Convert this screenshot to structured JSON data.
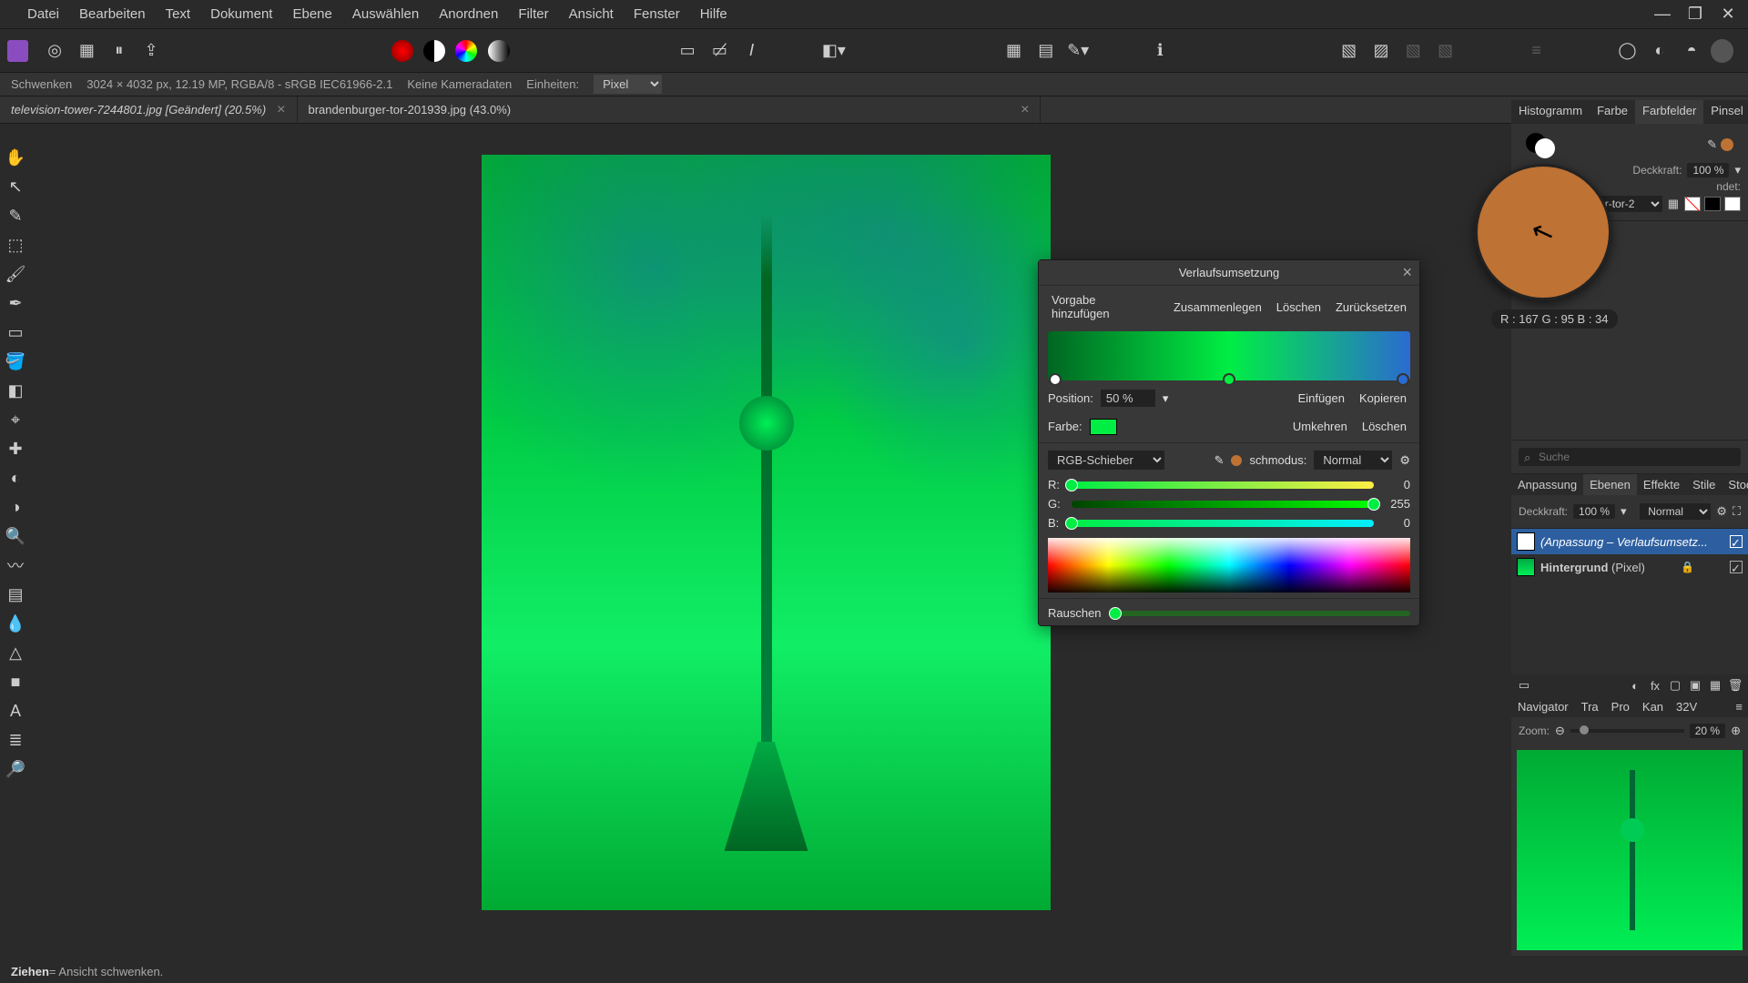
{
  "window": {
    "minimize": "—",
    "maximize": "❐",
    "close": "✕"
  },
  "menu": [
    "Datei",
    "Bearbeiten",
    "Text",
    "Dokument",
    "Ebene",
    "Auswählen",
    "Anordnen",
    "Filter",
    "Ansicht",
    "Fenster",
    "Hilfe"
  ],
  "info": {
    "tool": "Schwenken",
    "dims": "3024 × 4032 px, 12.19 MP, RGBA/8 - sRGB IEC61966-2.1",
    "camera": "Keine Kameradaten",
    "units_label": "Einheiten:",
    "units_value": "Pixel"
  },
  "tabs": [
    {
      "label": "television-tower-7244801.jpg [Geändert] (20.5%)"
    },
    {
      "label": "brandenburger-tor-201939.jpg (43.0%)"
    }
  ],
  "dialog": {
    "title": "Verlaufsumsetzung",
    "add_preset": "Vorgabe hinzufügen",
    "merge": "Zusammenlegen",
    "delete": "Löschen",
    "reset": "Zurücksetzen",
    "position_label": "Position:",
    "position_value": "50 %",
    "color_label": "Farbe:",
    "insert": "Einfügen",
    "copy": "Kopieren",
    "invert": "Umkehren",
    "delete2": "Löschen",
    "slider_mode": "RGB-Schieber",
    "blend_label": "schmodus:",
    "blend_value": "Normal",
    "r_label": "R:",
    "g_label": "G:",
    "b_label": "B:",
    "r_value": "0",
    "g_value": "255",
    "b_value": "0",
    "noise_label": "Rauschen"
  },
  "magnifier": {
    "readout": "R : 167 G : 95 B : 34"
  },
  "right": {
    "top_tabs": [
      "Histogramm",
      "Farbe",
      "Farbfelder",
      "Pinsel"
    ],
    "opacity_label": "Deckkraft:",
    "opacity_value": "100 %",
    "recent_label": "ndet:",
    "recent_name": "r-tor-2",
    "search_placeholder": "Suche",
    "mid_tabs": [
      "Anpassung",
      "Ebenen",
      "Effekte",
      "Stile",
      "Stock"
    ],
    "opacity2_label": "Deckkraft:",
    "opacity2_value": "100 %",
    "blend_value": "Normal",
    "layers": [
      {
        "name": "(Anpassung – Verlaufsumsetz..."
      },
      {
        "name_bold": "Hintergrund",
        "name_rest": " (Pixel)"
      }
    ],
    "nav_tabs": [
      "Navigator",
      "Tra",
      "Pro",
      "Kan",
      "32V"
    ],
    "zoom_label": "Zoom:",
    "zoom_value": "20 %"
  },
  "status": {
    "bold": "Ziehen",
    "rest": " = Ansicht schwenken."
  }
}
